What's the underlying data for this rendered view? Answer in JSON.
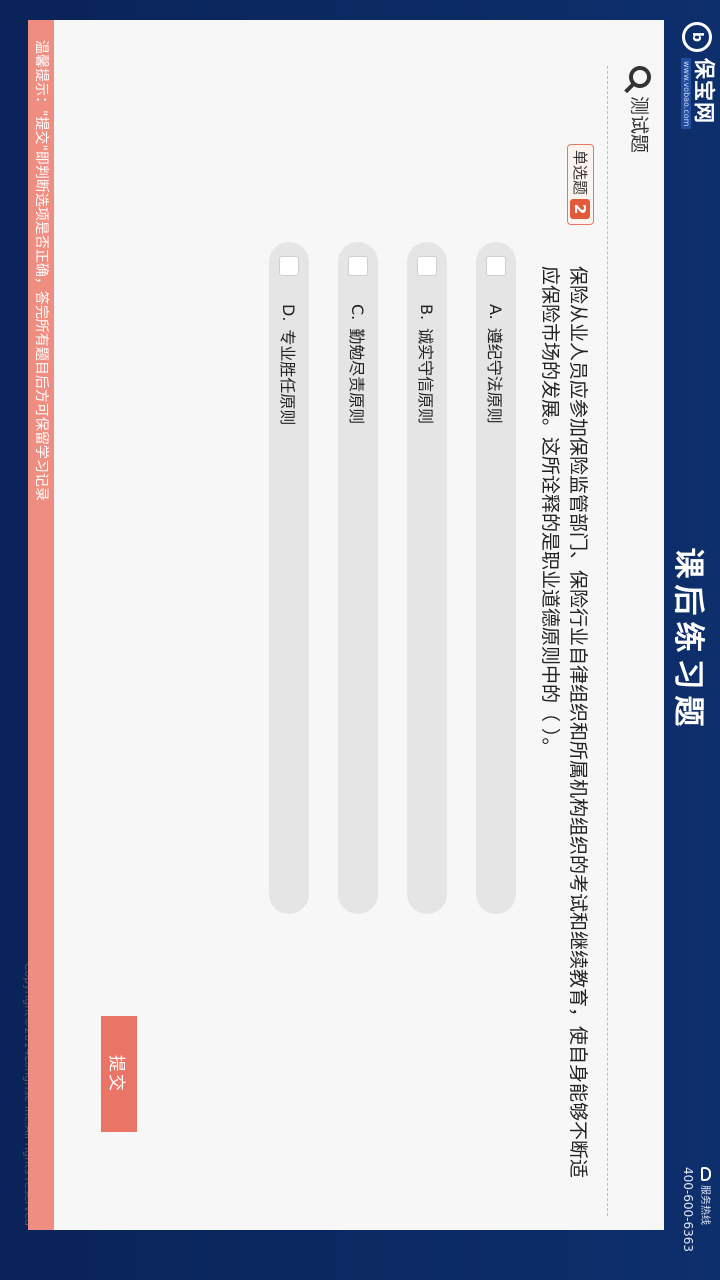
{
  "header": {
    "logo_mark": "b",
    "brand_name": "保宝网",
    "brand_url": "www.vobao.com",
    "title": "课后练习题",
    "hotline_label": "服务热线",
    "hotline_number": "400-600-6363"
  },
  "panel": {
    "section_title": "测试题",
    "question_type": "单选题",
    "question_number": "2",
    "question_text": "保险从业人员应参加保险监管部门、保险行业自律组织和所属机构组织的考试和继续教育，使自身能够不断适应保险市场的发展。这所诠释的是职业道德原则中的（ ）。",
    "options": [
      {
        "letter": "A.",
        "text": "遵纪守法原则"
      },
      {
        "letter": "B.",
        "text": "诚实守信原则"
      },
      {
        "letter": "C.",
        "text": "勤勉尽责原则"
      },
      {
        "letter": "D.",
        "text": "专业胜任原则"
      }
    ],
    "copyright": "Copyright©2014Longrise Inc.All rights reserved",
    "submit_label": "提交",
    "tip_text": "温馨提示：\"提交\"即判断选项是否正确，答完所有题目后方可保留学习记录"
  },
  "colors": {
    "background": "#0b2a63",
    "accent": "#ea7566",
    "tips_bar": "#ef8d80",
    "badge_number": "#e15a3c"
  }
}
